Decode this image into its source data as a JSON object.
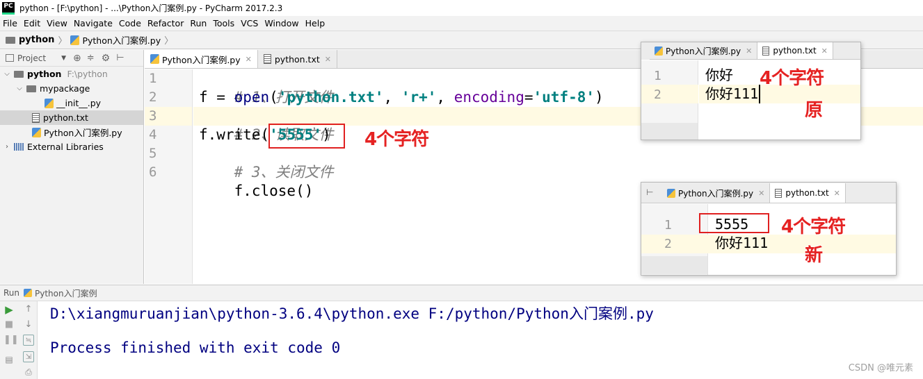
{
  "window": {
    "title": "python - [F:\\python] - ...\\Python入门案例.py - PyCharm 2017.2.3",
    "app_icon": "PC"
  },
  "menu": [
    "File",
    "Edit",
    "View",
    "Navigate",
    "Code",
    "Refactor",
    "Run",
    "Tools",
    "VCS",
    "Window",
    "Help"
  ],
  "breadcrumb": {
    "project": "python",
    "file": "Python入门案例.py"
  },
  "project_panel": {
    "title": "Project",
    "tree": [
      {
        "label": "python",
        "path": "F:\\python",
        "level": 0,
        "expanded": true,
        "kind": "folder"
      },
      {
        "label": "mypackage",
        "level": 1,
        "expanded": true,
        "kind": "package"
      },
      {
        "label": "__init__.py",
        "level": 2,
        "kind": "py"
      },
      {
        "label": "python.txt",
        "level": 1,
        "kind": "txt",
        "selected": true
      },
      {
        "label": "Python入门案例.py",
        "level": 1,
        "kind": "py"
      },
      {
        "label": "External Libraries",
        "level": 0,
        "expanded": false,
        "kind": "lib"
      }
    ]
  },
  "editor": {
    "tabs": [
      {
        "label": "Python入门案例.py",
        "active": true
      },
      {
        "label": "python.txt",
        "active": false
      }
    ],
    "line_numbers": [
      "1",
      "2",
      "3",
      "4",
      "5",
      "6"
    ],
    "code": {
      "l1": "# 1、打开文件",
      "l2_a": "f = ",
      "l2_fn": "open",
      "l2_b": "(",
      "l2_s1": "'python.txt'",
      "l2_c": ", ",
      "l2_s2": "'r+'",
      "l2_d": ", ",
      "l2_kw": "encoding",
      "l2_e": "=",
      "l2_s3": "'utf-8'",
      "l2_f": ")",
      "l3": "# 2、读取文件",
      "l4_a": "f.write(",
      "l4_s": "'5555'",
      "l4_b": ")",
      "l5": "# 3、关闭文件",
      "l6": "f.close()"
    },
    "annotation": "4个字符"
  },
  "popup_original": {
    "tabs": [
      "Python入门案例.py",
      "python.txt"
    ],
    "line_numbers": [
      "1",
      "2"
    ],
    "lines": [
      "你好",
      "你好111"
    ],
    "annotation": "4个字符",
    "label": "原"
  },
  "popup_new": {
    "tabs": [
      "Python入门案例.py",
      "python.txt"
    ],
    "line_numbers": [
      "1",
      "2"
    ],
    "lines": [
      "5555",
      "你好111"
    ],
    "annotation": "4个字符",
    "label": "新"
  },
  "run_panel": {
    "label": "Run",
    "config": "Python入门案例",
    "console": [
      "D:\\xiangmuruanjian\\python-3.6.4\\python.exe F:/python/Python入门案例.py",
      "",
      "Process finished with exit code 0"
    ]
  },
  "watermark": "CSDN @唯元素"
}
